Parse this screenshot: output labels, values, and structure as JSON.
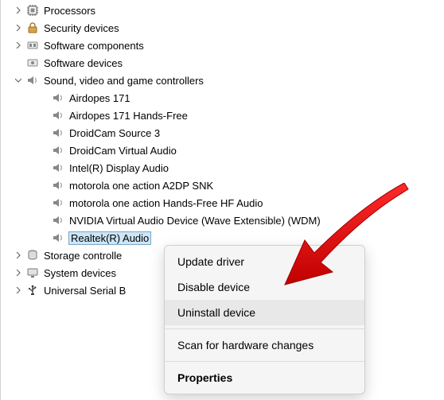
{
  "tree": {
    "categories": [
      {
        "label": "Processors",
        "icon": "cpu",
        "expanded": false,
        "twisty": "right"
      },
      {
        "label": "Security devices",
        "icon": "security",
        "expanded": false,
        "twisty": "right"
      },
      {
        "label": "Software components",
        "icon": "software-component",
        "expanded": false,
        "twisty": "right"
      },
      {
        "label": "Software devices",
        "icon": "software-device",
        "expanded": false,
        "twisty": "none"
      },
      {
        "label": "Sound, video and game controllers",
        "icon": "speaker",
        "expanded": true,
        "twisty": "down",
        "children": [
          {
            "label": "Airdopes 171",
            "icon": "speaker"
          },
          {
            "label": "Airdopes 171 Hands-Free",
            "icon": "speaker"
          },
          {
            "label": "DroidCam Source 3",
            "icon": "speaker"
          },
          {
            "label": "DroidCam Virtual Audio",
            "icon": "speaker"
          },
          {
            "label": "Intel(R) Display Audio",
            "icon": "speaker"
          },
          {
            "label": "motorola one action A2DP SNK",
            "icon": "speaker"
          },
          {
            "label": "motorola one action Hands-Free HF Audio",
            "icon": "speaker"
          },
          {
            "label": "NVIDIA Virtual Audio Device (Wave Extensible) (WDM)",
            "icon": "speaker"
          },
          {
            "label": "Realtek(R) Audio",
            "icon": "speaker",
            "selected": true
          }
        ]
      },
      {
        "label": "Storage controlle",
        "icon": "storage",
        "expanded": false,
        "twisty": "right"
      },
      {
        "label": "System devices",
        "icon": "system",
        "expanded": false,
        "twisty": "right"
      },
      {
        "label": "Universal Serial B",
        "icon": "usb",
        "expanded": false,
        "twisty": "right"
      }
    ]
  },
  "context_menu": {
    "items": [
      {
        "label": "Update driver",
        "type": "item"
      },
      {
        "label": "Disable device",
        "type": "item"
      },
      {
        "label": "Uninstall device",
        "type": "item",
        "hover": true
      },
      {
        "type": "sep"
      },
      {
        "label": "Scan for hardware changes",
        "type": "item"
      },
      {
        "type": "sep"
      },
      {
        "label": "Properties",
        "type": "item",
        "bold": true
      }
    ]
  },
  "highlight": {
    "arrow_color": "#e21b1b"
  }
}
